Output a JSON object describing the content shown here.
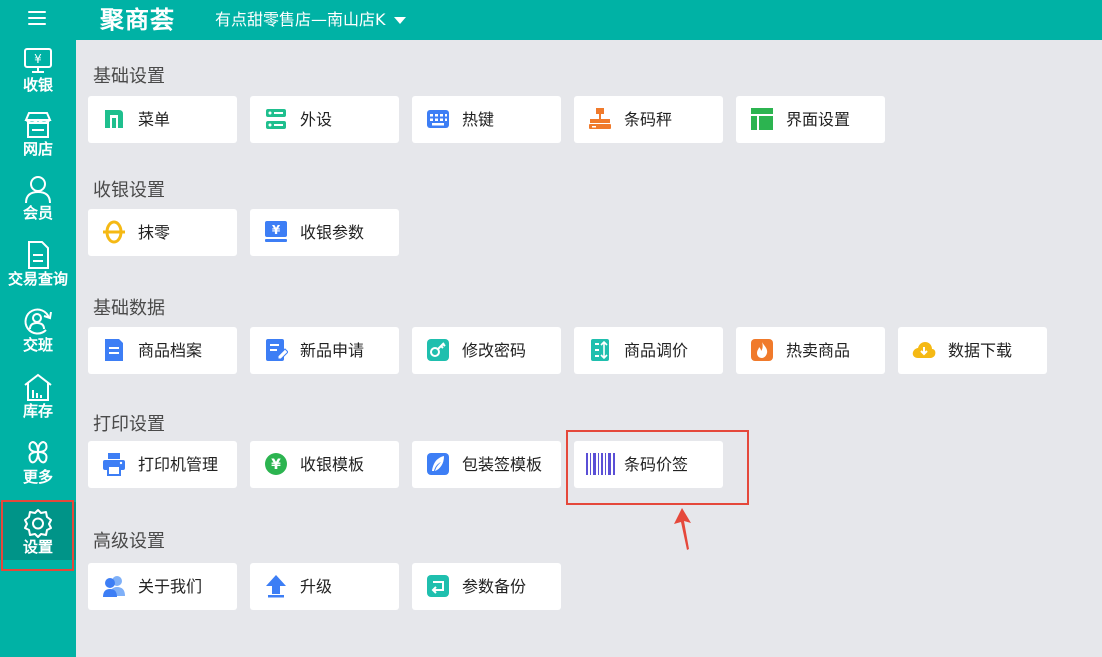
{
  "app": {
    "logo_text": "聚商荟",
    "store_name": "有点甜零售店—南山店K"
  },
  "sidebar": {
    "items": [
      {
        "label": "收银",
        "icon": "cash-register-icon"
      },
      {
        "label": "网店",
        "icon": "store-icon"
      },
      {
        "label": "会员",
        "icon": "member-icon"
      },
      {
        "label": "交易查询",
        "icon": "document-icon"
      },
      {
        "label": "交班",
        "icon": "shift-icon"
      },
      {
        "label": "库存",
        "icon": "warehouse-icon"
      },
      {
        "label": "更多",
        "icon": "more-icon"
      },
      {
        "label": "设置",
        "icon": "gear-icon"
      }
    ],
    "active": "设置"
  },
  "sections": [
    {
      "title": "基础设置",
      "items": [
        {
          "label": "菜单",
          "icon": "menu-icon",
          "color": "#1fbf8e"
        },
        {
          "label": "外设",
          "icon": "server-icon",
          "color": "#1fbf8e"
        },
        {
          "label": "热键",
          "icon": "keyboard-icon",
          "color": "#3d7ef5"
        },
        {
          "label": "条码秤",
          "icon": "scale-icon",
          "color": "#f07a2b"
        },
        {
          "label": "界面设置",
          "icon": "layout-icon",
          "color": "#2cb450"
        }
      ]
    },
    {
      "title": "收银设置",
      "items": [
        {
          "label": "抹零",
          "icon": "round-off-icon",
          "color": "#f5b914"
        },
        {
          "label": "收银参数",
          "icon": "cash-params-icon",
          "color": "#3d7ef5"
        }
      ]
    },
    {
      "title": "基础数据",
      "items": [
        {
          "label": "商品档案",
          "icon": "product-file-icon",
          "color": "#3d7ef5"
        },
        {
          "label": "新品申请",
          "icon": "new-product-icon",
          "color": "#3d7ef5"
        },
        {
          "label": "修改密码",
          "icon": "key-icon",
          "color": "#1fbfae"
        },
        {
          "label": "商品调价",
          "icon": "price-adjust-icon",
          "color": "#1fbfae"
        },
        {
          "label": "热卖商品",
          "icon": "fire-icon",
          "color": "#f07a2b"
        },
        {
          "label": "数据下载",
          "icon": "cloud-download-icon",
          "color": "#f5b914"
        }
      ]
    },
    {
      "title": "打印设置",
      "items": [
        {
          "label": "打印机管理",
          "icon": "printer-icon",
          "color": "#3d7ef5"
        },
        {
          "label": "收银模板",
          "icon": "yen-coin-icon",
          "color": "#2cb450"
        },
        {
          "label": "包装签模板",
          "icon": "feather-icon",
          "color": "#3d7ef5"
        },
        {
          "label": "条码价签",
          "icon": "barcode-icon",
          "color": "#5a4fd6"
        }
      ]
    },
    {
      "title": "高级设置",
      "items": [
        {
          "label": "关于我们",
          "icon": "users-icon",
          "color": "#3d7ef5"
        },
        {
          "label": "升级",
          "icon": "upgrade-icon",
          "color": "#3d7ef5"
        },
        {
          "label": "参数备份",
          "icon": "backup-icon",
          "color": "#1fbfae"
        }
      ]
    }
  ],
  "colors": {
    "brand": "#00b2a5",
    "brand_active": "#009488",
    "highlight": "#e5483b",
    "background": "#e6e7eb"
  }
}
